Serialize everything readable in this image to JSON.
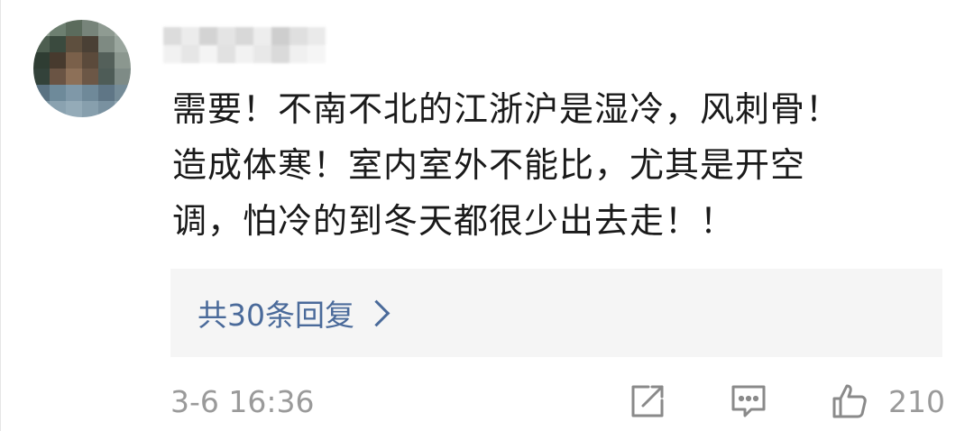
{
  "comment": {
    "lines": [
      "需要！不南不北的江浙沪是湿冷，风刺骨！",
      "造成体寒！室内室外不能比，尤其是开空",
      "调，怕冷的到冬天都很少出去走！！"
    ]
  },
  "replies": {
    "label": "共30条回复"
  },
  "footer": {
    "timestamp": "3-6 16:36",
    "like_count": "210"
  },
  "icons": {
    "share": "share-icon",
    "comment": "comment-icon",
    "like": "thumbs-up-icon",
    "chevron": "chevron-right-icon"
  },
  "colors": {
    "link": "#4a6a9a",
    "meta": "#9a9a9a",
    "text": "#1a1a1a",
    "reply_bg": "#f5f5f5"
  }
}
